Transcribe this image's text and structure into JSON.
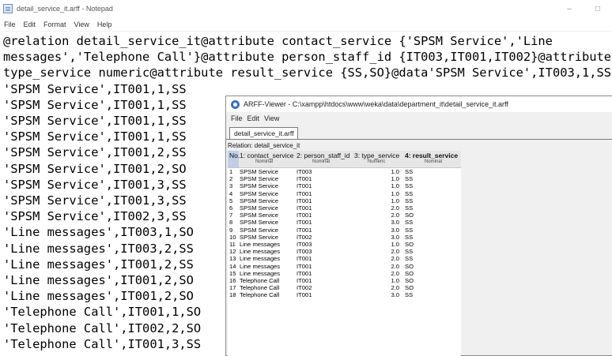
{
  "notepad": {
    "title": "detail_service_it.arff - Notepad",
    "window_controls": {
      "minimize": "–",
      "maximize": "□"
    },
    "menu": [
      "File",
      "Edit",
      "Format",
      "View",
      "Help"
    ],
    "lines": [
      "@relation detail_service_it@attribute contact_service {'SPSM Service','Line",
      "messages','Telephone Call'}@attribute person_staff_id {IT003,IT001,IT002}@attribute",
      "type_service numeric@attribute result_service {SS,SO}@data'SPSM Service',IT003,1,SS",
      "'SPSM Service',IT001,1,SS",
      "'SPSM Service',IT001,1,SS",
      "'SPSM Service',IT001,1,SS",
      "'SPSM Service',IT001,1,SS",
      "'SPSM Service',IT001,2,SS",
      "'SPSM Service',IT001,2,SO",
      "'SPSM Service',IT001,3,SS",
      "'SPSM Service',IT001,3,SS",
      "'SPSM Service',IT002,3,SS",
      "'Line messages',IT003,1,SO",
      "'Line messages',IT003,2,SS",
      "'Line messages',IT001,2,SS",
      "'Line messages',IT001,2,SO",
      "'Line messages',IT001,2,SO",
      "'Telephone Call',IT001,1,SO",
      "'Telephone Call',IT002,2,SO",
      "'Telephone Call',IT001,3,SS"
    ]
  },
  "viewer": {
    "title": "ARFF-Viewer - C:\\xampp\\htdocs\\www\\weka\\data\\department_it\\detail_service_it.arff",
    "menu": [
      "File",
      "Edit",
      "View"
    ],
    "tab": "detail_service_it.arff",
    "relation": "Relation: detail_service_it",
    "columns": [
      {
        "name": "No.",
        "type": ""
      },
      {
        "name": "1: contact_service",
        "type": "Nominal"
      },
      {
        "name": "2: person_staff_id",
        "type": "Nominal"
      },
      {
        "name": "3: type_service",
        "type": "Numeric"
      },
      {
        "name": "4: result_service",
        "type": "Nominal"
      }
    ],
    "rows": [
      [
        "1",
        "SPSM Service",
        "IT003",
        "1.0",
        "SS"
      ],
      [
        "2",
        "SPSM Service",
        "IT001",
        "1.0",
        "SS"
      ],
      [
        "3",
        "SPSM Service",
        "IT001",
        "1.0",
        "SS"
      ],
      [
        "4",
        "SPSM Service",
        "IT001",
        "1.0",
        "SS"
      ],
      [
        "5",
        "SPSM Service",
        "IT001",
        "1.0",
        "SS"
      ],
      [
        "6",
        "SPSM Service",
        "IT001",
        "2.0",
        "SS"
      ],
      [
        "7",
        "SPSM Service",
        "IT001",
        "2.0",
        "SO"
      ],
      [
        "8",
        "SPSM Service",
        "IT001",
        "3.0",
        "SS"
      ],
      [
        "9",
        "SPSM Service",
        "IT001",
        "3.0",
        "SS"
      ],
      [
        "10",
        "SPSM Service",
        "IT002",
        "3.0",
        "SS"
      ],
      [
        "11",
        "Line messages",
        "IT003",
        "1.0",
        "SO"
      ],
      [
        "12",
        "Line messages",
        "IT003",
        "2.0",
        "SS"
      ],
      [
        "13",
        "Line messages",
        "IT001",
        "2.0",
        "SS"
      ],
      [
        "14",
        "Line messages",
        "IT001",
        "2.0",
        "SO"
      ],
      [
        "15",
        "Line messages",
        "IT001",
        "2.0",
        "SO"
      ],
      [
        "16",
        "Telephone Call",
        "IT001",
        "1.0",
        "SO"
      ],
      [
        "17",
        "Telephone Call",
        "IT002",
        "2.0",
        "SO"
      ],
      [
        "18",
        "Telephone Call",
        "IT001",
        "3.0",
        "SS"
      ]
    ]
  }
}
